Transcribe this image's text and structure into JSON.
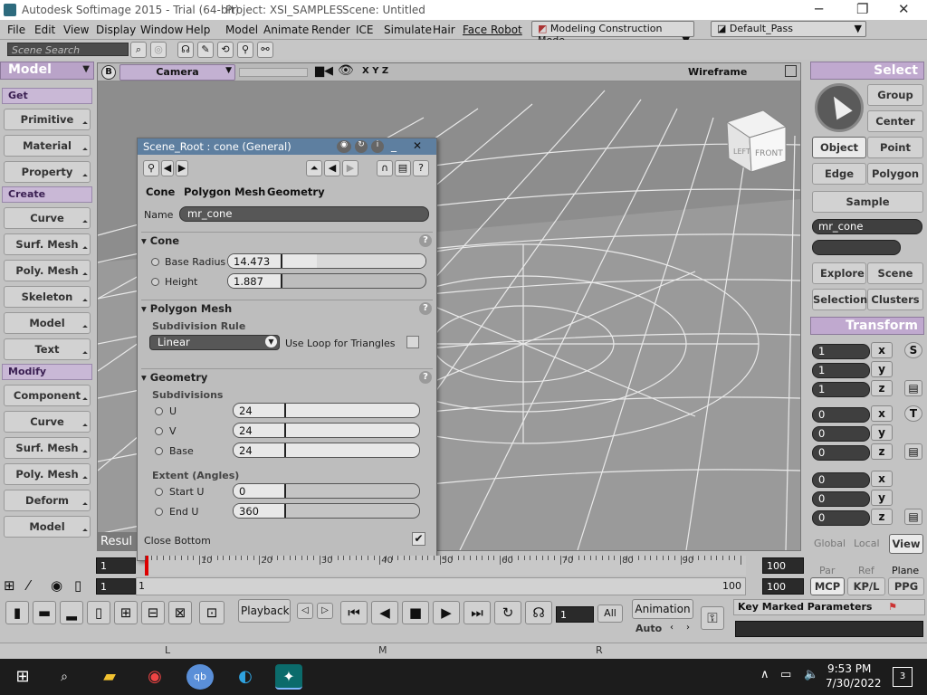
{
  "window": {
    "title": "Autodesk Softimage 2015 - Trial (64-bit)",
    "project": "Project: XSI_SAMPLES",
    "scene": "Scene: Untitled"
  },
  "menu": [
    "File",
    "Edit",
    "View",
    "Display",
    "Window",
    "Help",
    "Model",
    "Animate",
    "Render",
    "ICE",
    "Simulate",
    "Hair",
    "Face Robot"
  ],
  "mode_dropdown": "Modeling Construction Mode",
  "pass_dropdown": "Default_Pass",
  "search_placeholder": "Scene Search",
  "left_panel": {
    "header": "Model",
    "sections": [
      {
        "title": "Get",
        "items": [
          "Primitive",
          "Material",
          "Property"
        ]
      },
      {
        "title": "Create",
        "items": [
          "Curve",
          "Surf. Mesh",
          "Poly. Mesh",
          "Skeleton",
          "Model",
          "Text"
        ]
      },
      {
        "title": "Modify",
        "items": [
          "Component",
          "Curve",
          "Surf. Mesh",
          "Poly. Mesh",
          "Deform",
          "Model"
        ]
      }
    ]
  },
  "viewport": {
    "camera": "Camera",
    "axes": "X Y Z",
    "mode": "Wireframe",
    "cube_left": "LEFT",
    "cube_front": "FRONT",
    "result_label": "Resul"
  },
  "dialog": {
    "title": "Scene_Root : cone (General)",
    "tabs": [
      "Cone",
      "Polygon Mesh",
      "Geometry"
    ],
    "name_label": "Name",
    "name_value": "mr_cone",
    "cone_section": "Cone",
    "base_radius_label": "Base Radius",
    "base_radius_value": "14.473",
    "base_radius_fraction": 0.45,
    "height_label": "Height",
    "height_value": "1.887",
    "height_fraction": 0.05,
    "polymesh_section": "Polygon Mesh",
    "subdivision_rule_label": "Subdivision Rule",
    "subdivision_rule_value": "Linear",
    "use_loop_label": "Use Loop for Triangles",
    "geometry_section": "Geometry",
    "subdivisions_label": "Subdivisions",
    "u_label": "U",
    "u_value": "24",
    "v_label": "V",
    "v_value": "24",
    "base_label": "Base",
    "base_value": "24",
    "extent_label": "Extent (Angles)",
    "start_u_label": "Start U",
    "start_u_value": "0",
    "end_u_label": "End U",
    "end_u_value": "360",
    "close_bottom_label": "Close Bottom"
  },
  "right_panel": {
    "header": "Select",
    "buttons": [
      "Group",
      "Center",
      "Object",
      "Point",
      "Edge",
      "Polygon",
      "Sample"
    ],
    "selected": "Object",
    "name_field": "mr_cone",
    "explore": "Explore",
    "scene": "Scene",
    "selection": "Selection",
    "clusters": "Clusters",
    "transform_header": "Transform",
    "scale": [
      "1",
      "1",
      "1"
    ],
    "rotate": [
      "0",
      "0",
      "0"
    ],
    "translate": [
      "0",
      "0",
      "0"
    ],
    "axis_x": "x",
    "axis_y": "y",
    "axis_z": "z",
    "s_label": "S",
    "t_label": "T",
    "global": "Global",
    "local": "Local",
    "view": "View",
    "par": "Par",
    "ref": "Ref",
    "plane": "Plane",
    "mcp": "MCP",
    "kpl": "KP/L",
    "ppg": "PPG"
  },
  "timeline": {
    "start": "1",
    "end": "100",
    "ticks": [
      "10",
      "20",
      "30",
      "40",
      "50",
      "60",
      "70",
      "80",
      "90"
    ],
    "start_frame": "1",
    "field2": "1",
    "end_right": "100",
    "end_right2": "100"
  },
  "playback": {
    "label": "Playback",
    "current_frame": "1",
    "all": "All",
    "animation": "Animation",
    "auto": "Auto",
    "key_marked": "Key Marked Parameters"
  },
  "lmr": {
    "l": "L",
    "m": "M",
    "r": "R"
  },
  "taskbar": {
    "time": "9:53 PM",
    "date": "7/30/2022",
    "notif": "3"
  }
}
